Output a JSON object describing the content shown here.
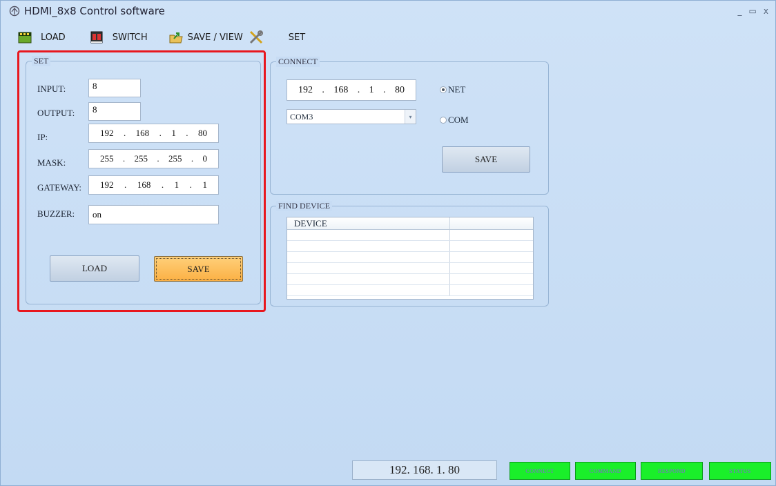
{
  "window": {
    "title": "HDMI_8x8 Control software",
    "controls": [
      "_",
      "▭",
      "x"
    ]
  },
  "toolbar": {
    "items": [
      {
        "label": "LOAD",
        "icon": "film-clapper-icon"
      },
      {
        "label": "SWITCH",
        "icon": "calendar-icon"
      },
      {
        "label": "SAVE / VIEW",
        "icon": "folder-arrow-icon"
      },
      {
        "label": "SET",
        "icon": "tools-icon"
      }
    ]
  },
  "set_panel": {
    "legend": "SET",
    "input_label": "INPUT:",
    "input_value": "8",
    "output_label": "OUTPUT:",
    "output_value": "8",
    "ip_label": "IP:",
    "ip": [
      "192",
      "168",
      "1",
      "80"
    ],
    "mask_label": "MASK:",
    "mask": [
      "255",
      "255",
      "255",
      "0"
    ],
    "gateway_label": "GATEWAY:",
    "gateway": [
      "192",
      "168",
      "1",
      "1"
    ],
    "buzzer_label": "BUZZER:",
    "buzzer_value": "on",
    "load_button": "LOAD",
    "save_button": "SAVE"
  },
  "connect_panel": {
    "legend": "CONNECT",
    "ip": [
      "192",
      "168",
      "1",
      "80"
    ],
    "net_label": "NET",
    "com_label": "COM",
    "com_port": "COM3",
    "save_button": "SAVE",
    "selected_mode": "NET"
  },
  "find_panel": {
    "legend": "FIND DEVICE",
    "columns": [
      "DEVICE",
      ""
    ]
  },
  "status": {
    "ip_display": "192. 168. 1. 80",
    "lamps": [
      "CONNECT",
      "COMMAND",
      "RESPOND",
      "STATUS"
    ],
    "lamp_color": "#1aef2a",
    "highlight_color": "#e8171e"
  }
}
